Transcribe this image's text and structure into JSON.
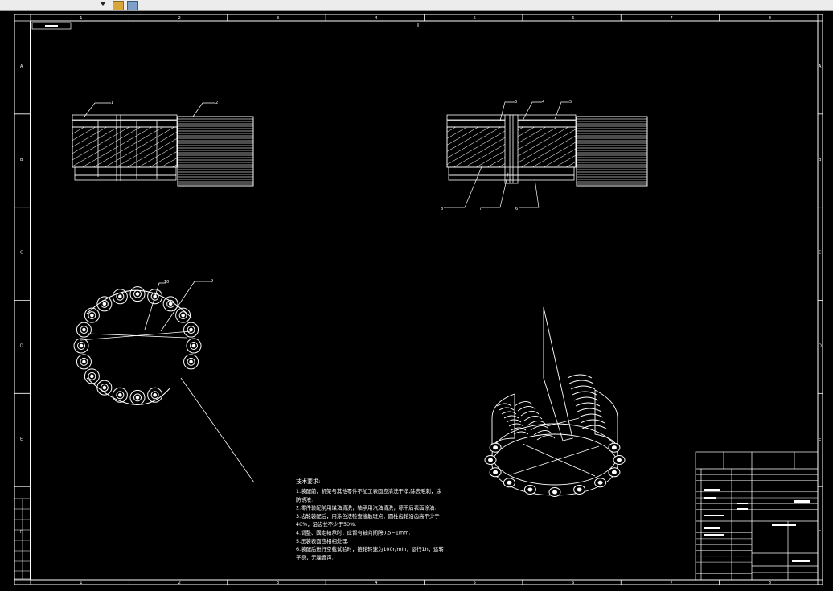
{
  "drawing": {
    "top_cols": [
      "1",
      "2",
      "3",
      "4",
      "5",
      "6",
      "7",
      "8"
    ],
    "bottom_cols": [
      "1",
      "2",
      "3",
      "4",
      "5",
      "6",
      "7",
      "8"
    ],
    "left_rows": [
      "A",
      "B",
      "C",
      "D",
      "E",
      "F"
    ],
    "right_rows": [
      "A",
      "B",
      "C",
      "D",
      "E",
      "F"
    ],
    "top_view_a_balloons": [
      "1",
      "2"
    ],
    "top_view_b_balloons": [
      "3",
      "4",
      "5",
      "8",
      "7",
      "6"
    ],
    "ring_balloons": [
      "10",
      "9"
    ]
  },
  "tech_requirements": {
    "title": "技术要求:",
    "items": [
      "1.装配前，机架与其他零件不加工表面应清洗干净,除去毛刺，涂",
      "防锈液.",
      "2.零件装配前用煤油清洗，轴承用汽油清洗，晾干后表面涂油.",
      "3.齿轮装配后，用涂色法检查接触斑点，圆柱齿轮沿齿高不少于",
      "40%，沿齿长不少于50%.",
      "4.调整、固定轴承时，应留有轴向间隙0.5~1mm.",
      "5.压装表面应相相处理.",
      "6.装配后进行空载试验时，链轮转速为100r/min，运行1h，运转",
      "平稳，无噪音声."
    ]
  },
  "colors": {
    "background": "#000000",
    "lines": "#ffffff",
    "toolbar": "#ececec"
  }
}
